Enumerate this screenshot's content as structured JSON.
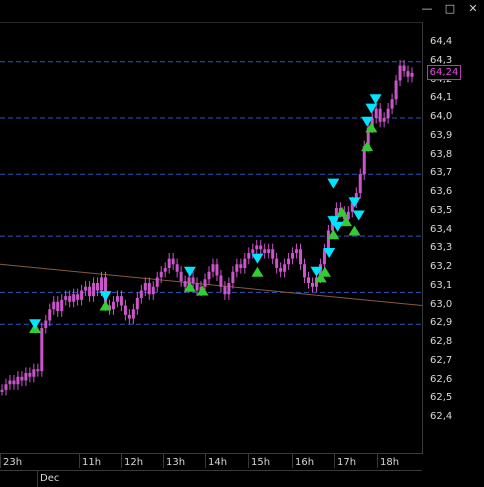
{
  "window": {
    "minimize_label": "—",
    "maximize_label": "□",
    "close_label": "✕"
  },
  "price_axis": {
    "ticks": [
      "64,4",
      "64,3",
      "64,2",
      "64,1",
      "64,0",
      "63,9",
      "63,8",
      "63,7",
      "63,6",
      "63,5",
      "63,4",
      "63,3",
      "63,2",
      "63,1",
      "63,0",
      "62,9",
      "62,8",
      "62,7",
      "62,6",
      "62,5",
      "62,4"
    ],
    "last_price": "64,24"
  },
  "time_axis": {
    "ticks": [
      "23h",
      "11h",
      "12h",
      "13h",
      "14h",
      "15h",
      "16h",
      "17h",
      "18h"
    ],
    "month": "Dec"
  },
  "colors": {
    "background": "#000000",
    "candle": "#cc55cc",
    "grid_dashed": "#3355bb",
    "trend_line": "#8a5a3a",
    "buy_marker": "#33cc33",
    "sell_marker": "#00e5ff",
    "axis_text": "#d8d8d8"
  },
  "chart_data": {
    "type": "candlestick",
    "y_range": [
      62.35,
      64.45
    ],
    "dashed_gridlines": [
      64.3,
      64.0,
      63.7,
      63.37,
      63.07,
      62.9
    ],
    "trendline": {
      "from": 63.22,
      "to": 63.0
    },
    "price_path": [
      62.55,
      62.58,
      62.6,
      62.58,
      62.62,
      62.6,
      62.64,
      62.62,
      62.66,
      62.65,
      62.88,
      62.92,
      62.98,
      63.02,
      62.97,
      63.03,
      63.05,
      63.02,
      63.06,
      63.03,
      63.08,
      63.1,
      63.05,
      63.12,
      63.08,
      63.15,
      63.0,
      62.98,
      63.02,
      63.05,
      63.0,
      62.95,
      62.93,
      62.98,
      63.04,
      63.08,
      63.12,
      63.06,
      63.1,
      63.15,
      63.18,
      63.2,
      63.25,
      63.22,
      63.18,
      63.13,
      63.1,
      63.15,
      63.12,
      63.08,
      63.1,
      63.14,
      63.18,
      63.22,
      63.16,
      63.1,
      63.06,
      63.12,
      63.18,
      63.22,
      63.2,
      63.25,
      63.28,
      63.3,
      63.32,
      63.3,
      63.28,
      63.3,
      63.25,
      63.2,
      63.18,
      63.22,
      63.25,
      63.28,
      63.3,
      63.22,
      63.15,
      63.12,
      63.1,
      63.15,
      63.22,
      63.3,
      63.4,
      63.45,
      63.52,
      63.5,
      63.46,
      63.5,
      63.55,
      63.6,
      63.7,
      63.85,
      63.95,
      64.0,
      64.05,
      63.98,
      64.0,
      64.05,
      64.1,
      64.2,
      64.28,
      64.25,
      64.22,
      64.24
    ],
    "buy_markers": [
      [
        0.083,
        62.88
      ],
      [
        0.25,
        63.0
      ],
      [
        0.45,
        63.1
      ],
      [
        0.48,
        63.08
      ],
      [
        0.61,
        63.18
      ],
      [
        0.76,
        63.15
      ],
      [
        0.77,
        63.18
      ],
      [
        0.79,
        63.38
      ],
      [
        0.81,
        63.5
      ],
      [
        0.82,
        63.45
      ],
      [
        0.84,
        63.4
      ],
      [
        0.87,
        63.85
      ],
      [
        0.88,
        63.95
      ]
    ],
    "sell_markers": [
      [
        0.083,
        62.9
      ],
      [
        0.25,
        63.05
      ],
      [
        0.45,
        63.18
      ],
      [
        0.61,
        63.25
      ],
      [
        0.75,
        63.18
      ],
      [
        0.78,
        63.28
      ],
      [
        0.79,
        63.65
      ],
      [
        0.79,
        63.45
      ],
      [
        0.8,
        63.42
      ],
      [
        0.84,
        63.55
      ],
      [
        0.85,
        63.48
      ],
      [
        0.87,
        63.98
      ],
      [
        0.88,
        64.05
      ],
      [
        0.89,
        64.1
      ]
    ]
  }
}
